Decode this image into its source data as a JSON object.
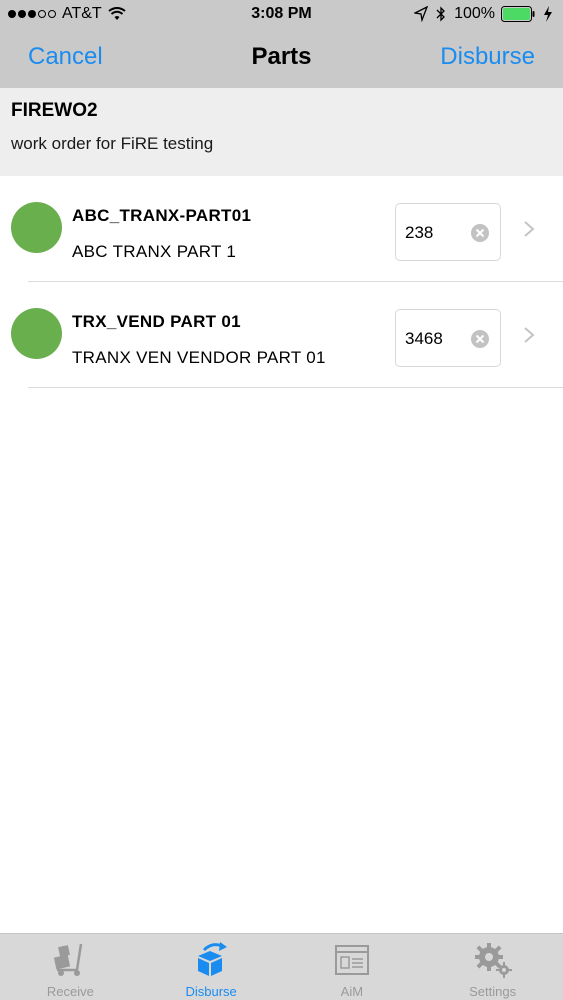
{
  "status_bar": {
    "carrier": "AT&T",
    "time": "3:08 PM",
    "battery_percent": "100%",
    "signal_bars_filled": 3,
    "signal_bars_total": 5
  },
  "nav": {
    "cancel_label": "Cancel",
    "title": "Parts",
    "disburse_label": "Disburse"
  },
  "work_order": {
    "id": "FIREWO2",
    "description": "work order for FiRE testing"
  },
  "parts": [
    {
      "code": "ABC_TRANX-PART01",
      "name": "ABC TRANX PART 1",
      "quantity": "238",
      "status_color": "#6aaf4e"
    },
    {
      "code": "TRX_VEND PART 01",
      "name": "TRANX VEN VENDOR PART 01",
      "quantity": "3468",
      "status_color": "#6aaf4e"
    }
  ],
  "tabs": [
    {
      "label": "Receive",
      "icon": "hand-truck-icon",
      "active": false
    },
    {
      "label": "Disburse",
      "icon": "disburse-box-icon",
      "active": true
    },
    {
      "label": "AiM",
      "icon": "aim-window-icon",
      "active": false
    },
    {
      "label": "Settings",
      "icon": "gears-icon",
      "active": false
    }
  ],
  "colors": {
    "accent": "#1a8cf0",
    "header_bg": "#c9c9c9",
    "banner_bg": "#eeeeee",
    "status_green": "#6aaf4e",
    "battery_green": "#4cd964"
  }
}
